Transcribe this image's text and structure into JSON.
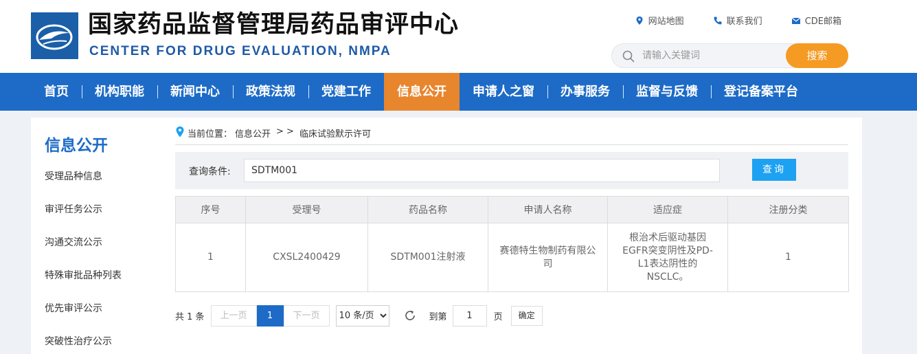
{
  "header": {
    "title_cn": "国家药品监督管理局药品审评中心",
    "title_en": "CENTER FOR DRUG EVALUATION, NMPA",
    "links": [
      {
        "label": "网站地图",
        "icon": "map-pin-icon"
      },
      {
        "label": "联系我们",
        "icon": "phone-icon"
      },
      {
        "label": "CDE邮箱",
        "icon": "mail-icon"
      }
    ],
    "search": {
      "placeholder": "请输入关键词",
      "button": "搜索"
    }
  },
  "nav": {
    "items": [
      "首页",
      "机构职能",
      "新闻中心",
      "政策法规",
      "党建工作",
      "信息公开",
      "申请人之窗",
      "办事服务",
      "监督与反馈",
      "登记备案平台"
    ],
    "active": "信息公开"
  },
  "sidebar": {
    "title": "信息公开",
    "items": [
      "受理品种信息",
      "审评任务公示",
      "沟通交流公示",
      "特殊审批品种列表",
      "优先审评公示",
      "突破性治疗公示"
    ]
  },
  "breadcrumb": {
    "prefix": "当前位置：",
    "level1": "信息公开",
    "sep": "> >",
    "level2": "临床试验默示许可"
  },
  "query": {
    "label": "查询条件:",
    "value": "SDTM001",
    "button": "查询"
  },
  "table": {
    "headers": [
      "序号",
      "受理号",
      "药品名称",
      "申请人名称",
      "适应症",
      "注册分类"
    ],
    "rows": [
      [
        "1",
        "CXSL2400429",
        "SDTM001注射液",
        "赛德特生物制药有限公司",
        "根治术后驱动基因EGFR突变阴性及PD-L1表达阴性的NSCLC。",
        "1"
      ]
    ]
  },
  "pagination": {
    "total_label": "共 1 条",
    "prev": "上一页",
    "current": "1",
    "next": "下一页",
    "page_size": "10 条/页",
    "goto_label": "到第",
    "goto_value": "1",
    "page_unit": "页",
    "confirm": "确定"
  },
  "colors": {
    "nav_bg": "#1d6bc7",
    "nav_active": "#e8862e",
    "search_btn": "#f59a23",
    "query_btn": "#1da1f2"
  }
}
